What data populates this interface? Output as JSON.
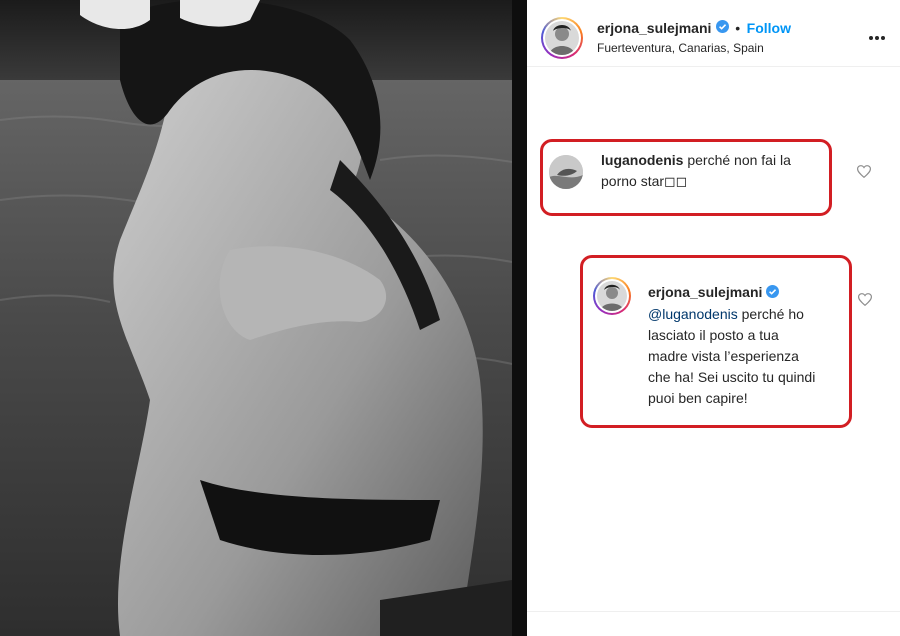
{
  "post": {
    "image_alt_icon": "photo-image",
    "author": "erjona_sulejmani",
    "follow_label": "Follow",
    "dot": "•",
    "location": "Fuerteventura, Canarias, Spain",
    "more_icon": "more-dots-icon"
  },
  "comments": [
    {
      "username": "luganodenis",
      "text": "perché non fai la porno star◻◻",
      "line1": " perché non fai la",
      "line2": "porno star◻◻"
    }
  ],
  "reply": {
    "username": "erjona_sulejmani",
    "mention": "@luganodenis",
    "line1_rest": " perché ho",
    "line2": "lasciato il posto a tua",
    "line3": "madre vista l’esperienza",
    "line4": "che ha! Sei uscito tu quindi",
    "line5": "puoi ben capire!"
  },
  "colors": {
    "highlight": "#d21e23",
    "link": "#0095f6",
    "verified": "#3897f0"
  }
}
